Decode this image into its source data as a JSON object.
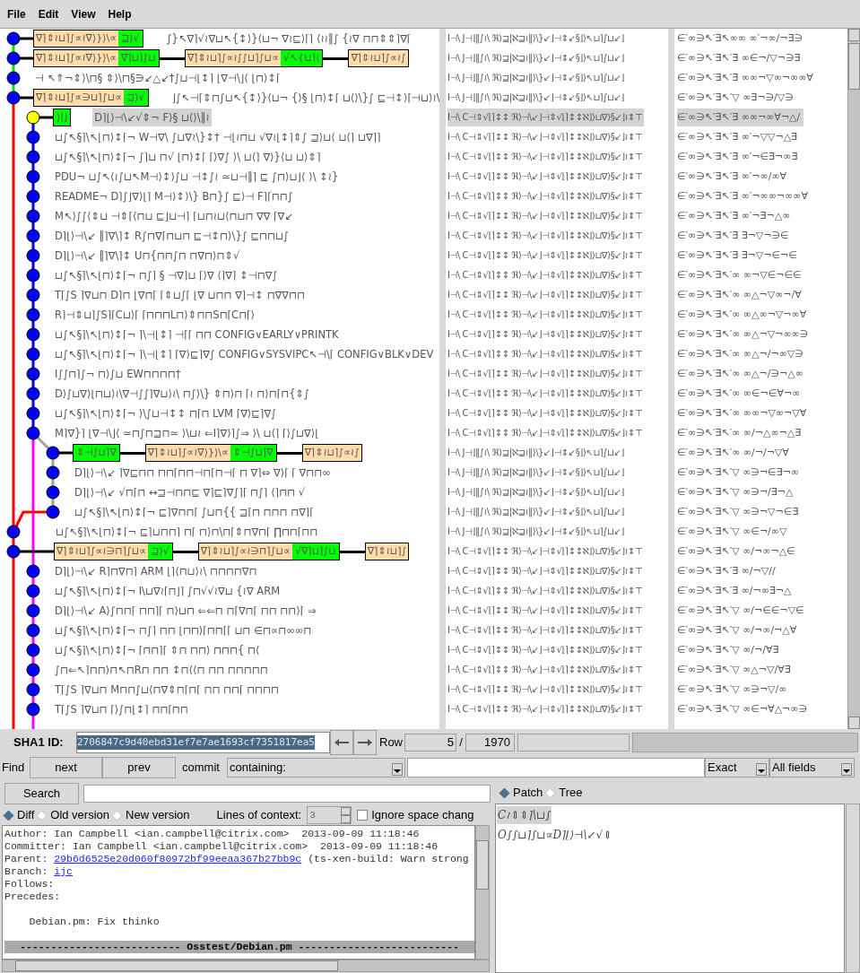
{
  "menu": [
    "File",
    "Edit",
    "View",
    "Help"
  ],
  "commits": [
    {
      "kind": "commit",
      "selected": false,
      "labels": [
        {
          "remote": "∇⌉⇕≀⊔⌉∫∝≀∇⟩}⟩\\∝",
          "branch": "⊒⟩√"
        }
      ],
      "subject": "∫}↖∇⌉√≀∇⊔↖{↕⟩}⟨⊔¬ ∇≀⊑⟩⌈⌉ ⟨≀≀‖∫ {≀∇ ⊓⊓⇕⇕⌉∇⌈",
      "author": "I⊣\\ J⊣⌋‖∫≀\\ ℜ⟩⊒|ℵ⊒≀‖⟩\\}↙⌋⊣⇕↙§⌋⟩↖⊔⌉∫⊔↙⌋",
      "date": "∈′∞∋↖′∃↖∞∞ ∞′¬∞/¬∃∋"
    },
    {
      "kind": "commit",
      "selected": false,
      "labels": [
        {
          "remote": "∇⌉⇕≀⊔⌉∫∝≀∇⟩}⟩\\∝",
          "branch": "∇⌉⊔⌉∫⊔"
        },
        {
          "remote": "∇⌉⇕≀⊔⌉∫∝≀∫∫⊔⌉∫⊔∝",
          "branch": "√↖{⊔⌉⟨"
        },
        {
          "remote": "∇⌉⇕≀⊔⌉∫∝≀∫"
        }
      ],
      "author": "I⊣\\ J⊣⌋‖∫≀\\ ℜ⟩⊒|ℵ⊒≀‖⟩\\}↙⌋⊣⇕↙§⌋⟩↖⊔⌉∫⊔↙⌋",
      "date": "∈′∞∋↖′∃↖′∃ ∞∈¬/▽¬∋∃"
    },
    {
      "kind": "commit",
      "selected": false,
      "subject": "⊣ ↖⇑¬⇕⟩\\⊓§ ⇕⟩\\⊓§∋↙△↙†∫⊔⊣⌊↕⌉ ⌊∇⊣\\⌋⟨ ⌊⊓⟩↕⌈",
      "author": "I⊣\\ J⊣⌋‖∫≀\\ ℜ⟩⊒|ℵ⊒≀‖⟩\\}↙⌋⊣⇕↙§⌋⟩↖⊔⌉∫⊔↙⌋",
      "date": "∈′∞∋↖′∃↖′∃ ∞∞¬▽∞¬∞∞∀"
    },
    {
      "kind": "commit",
      "selected": false,
      "labels": [
        {
          "remote": "∇⌉⇕≀⊔⌉∫∝∋⊔⌉∫⊔∝",
          "branch": "⊒⟩√"
        }
      ],
      "subject": "⌋∫↖⊣⌈⇕⊓∫⊔↖{↕⟩}⟨⊔¬ {⟩§ ⌊⊓⟩↕⌈ ⊔⟨⟩\\}∫ ⊑⊣↕⟩⌈⊣⊔⟩≀\\",
      "author": "I⊣\\ J⊣⌋‖∫≀\\ ℜ⟩⊒|ℵ⊒≀‖⟩\\}↙⌋⊣⇕↙§⌋⟩↖⊔⌉∫⊔↙⌋",
      "date": "∈′∞∋↖′∃↖′▽ ∞∃¬∋/▽∋"
    },
    {
      "kind": "head",
      "selected": true,
      "labels": [
        {
          "branch": "⟩|⌋"
        }
      ],
      "subject": "D⌉⌊⟩⊣\\↙√⇕¬ F⟩§ ⊔⟨⟩\\‖≀",
      "author": "I⊣\\ C⊣⇕√⌊⌉↕↕ ℜ⟩⊣\\↙⌋⊣⇕√⌊⌉↕↕ℵ⌋⟩⊔∇⟩§↙⌋≀⇕⊤",
      "date": "∈′∞∋↖′∃↖′∃ ∞∞¬∞∀¬△/"
    },
    {
      "kind": "commit",
      "selected": false,
      "subject": "⊔∫↖§⌉\\↖⌊⊓⟩↕⌈¬ W⊣∇\\ ∫⊔∇≀\\}↕† ⊣⌊≀⊓⊔ √∇≀⌊↕⌉⇕∫ ⊒⟩⊔⟨ ⊔⟨⌉ ⊔∇⌉⌉",
      "author": "I⊣\\ C⊣⇕√⌊⌉↕↕ ℜ⟩⊣\\↙⌋⊣⇕√⌊⌉↕↕ℵ⌋⟩⊔∇⟩§↙⌋≀⇕⊤",
      "date": "∈′∞∋↖′∃↖′∃ ∞′¬▽▽¬△∃"
    },
    {
      "kind": "commit",
      "selected": false,
      "subject": "⊔∫↖§⌉\\↖⌊⊓⟩↕⌈¬ ∫⌉⊔ ⊓√ ⌊⊓⟩↕⌈ ⌈⟩∇∫ ⟩\\ ⊔⟨⌉ ∇⟩}⟨⊔ ⊔⟩⇕⌉",
      "author": "I⊣\\ C⊣⇕√⌊⌉↕↕ ℜ⟩⊣\\↙⌋⊣⇕√⌊⌉↕↕ℵ⌋⟩⊔∇⟩§↙⌋≀⇕⊤",
      "date": "∈′∞∋↖′∃↖′∃ ∞′¬∈∃¬∞∃"
    },
    {
      "kind": "commit",
      "selected": false,
      "subject": "PDU¬ ⊔∫↖⟨≀∫⊔↖M⊣⟩↕⟩∫⊔ ⊣↕∫≀ ≃⊔⊣‖⌉ ⊑ ∫⊓⟩⊔⌋⟨ ⟩\\ ↕≀}",
      "author": "I⊣\\ C⊣⇕√⌊⌉↕↕ ℜ⟩⊣\\↙⌋⊣⇕√⌊⌉↕↕ℵ⌋⟩⊔∇⟩§↙⌋≀⇕⊤",
      "date": "∈′∞∋↖′∃↖′∃ ∞′¬∞/∞∀"
    },
    {
      "kind": "commit",
      "selected": false,
      "subject": "README¬ D⌉∫⌋∇⟩⌊⌉ M⊣⟩↕⟩\\} B⊓}∫ ⊑⟩⊣ F⌉⌈⊓⊓∫",
      "author": "I⊣\\ C⊣⇕√⌊⌉↕↕ ℜ⟩⊣\\↙⌋⊣⇕√⌊⌉↕↕ℵ⌋⟩⊔∇⟩§↙⌋≀⇕⊤",
      "date": "∈′∞∋↖′∃↖′∃ ∞′¬∞∞¬∞∞∀"
    },
    {
      "kind": "commit",
      "selected": false,
      "subject": "M↖⟩∫∫⟨⇕⊔ ⊣⇕⌈⟨⊓⊔ ⊑⌋⊔⊣⌉ ⌈⊔⊓≀⊔⟨⊓⊔⊓ ∇∇ ⌈∇↙",
      "author": "I⊣\\ C⊣⇕√⌊⌉↕↕ ℜ⟩⊣\\↙⌋⊣⇕√⌊⌉↕↕ℵ⌋⟩⊔∇⟩§↙⌋≀⇕⊤",
      "date": "∈′∞∋↖′∃↖′∃ ∞′¬∃¬△∞"
    },
    {
      "kind": "commit",
      "selected": false,
      "subject": "D⌉⌊⟩⊣\\↙ ‖⌉∇\\⌉↕ R∫⊓∇⌈⊓⊔⊓ ⊑⊣↕⊓⟩\\}∫ ⊑⊓⊓⊔∫",
      "author": "I⊣\\ C⊣⇕√⌊⌉↕↕ ℜ⟩⊣\\↙⌋⊣⇕√⌊⌉↕↕ℵ⌋⟩⊔∇⟩§↙⌋≀⇕⊤",
      "date": "∈′∞∋↖′∃↖′∃ ∃¬▽¬∋∈"
    },
    {
      "kind": "commit",
      "selected": false,
      "subject": "D⌉⌊⟩⊣\\↙ ‖⌉∇\\⌉↕ U⊓{⊓⊓∫⊓ ⊓∇⊓⟩⊓⇕√",
      "author": "I⊣\\ C⊣⇕√⌊⌉↕↕ ℜ⟩⊣\\↙⌋⊣⇕√⌊⌉↕↕ℵ⌋⟩⊔∇⟩§↙⌋≀⇕⊤",
      "date": "∈′∞∋↖′∃↖′∃ ∃¬▽¬∈¬∈"
    },
    {
      "kind": "commit",
      "selected": false,
      "subject": "⊔∫↖§⌉\\↖⌊⊓⟩↕⌈¬ ⊓∫⌉ § ⊣∇⌉⊔ ⌈⟩∇ ⟨⌉∇⌉ ↕⊣⊓∇∫",
      "author": "I⊣\\ C⊣⇕√⌊⌉↕↕ ℜ⟩⊣\\↙⌋⊣⇕√⌊⌉↕↕ℵ⌋⟩⊔∇⟩§↙⌋≀⇕⊤",
      "date": "∈′∞∋↖′∃↖′∞ ∞¬▽∈¬∈∈"
    },
    {
      "kind": "commit",
      "selected": false,
      "subject": "T⌈∫S ⌉∇⊔⊓ D⌉⊓ ⌊∇⊓⌈ ⌈⇕⊔∫⌈ ⌊∇ ⊔⊓⊓ ∇⌉⊣↕ ⊓∇∇⊓⊓",
      "author": "I⊣\\ C⊣⇕√⌊⌉↕↕ ℜ⟩⊣\\↙⌋⊣⇕√⌊⌉↕↕ℵ⌋⟩⊔∇⟩§↙⌋≀⇕⊤",
      "date": "∈′∞∋↖′∃↖′∞ ∞△¬▽∞¬/∀"
    },
    {
      "kind": "commit",
      "selected": false,
      "subject": "R⌉⊣⇕⊔⌉∫S⌉⌈C⊔⟩⌈ ⌈⊓⊓⊓L⊓⟩⇕⊓⊓S⊓⌈C⊓⌈⟩",
      "author": "I⊣\\ C⊣⇕√⌊⌉↕↕ ℜ⟩⊣\\↙⌋⊣⇕√⌊⌉↕↕ℵ⌋⟩⊔∇⟩§↙⌋≀⇕⊤",
      "date": "∈′∞∋↖′∃↖′∞ ∞△∞¬▽¬∞∀"
    },
    {
      "kind": "commit",
      "selected": false,
      "subject": "⊔∫↖§⌉\\↖⌊⊓⟩↕⌈¬ ⌉\\⊣⌊↕⌉ ⊣⌈⌈ ⊓⊓ CONFIG∨EARLY∨PRINTK",
      "author": "I⊣\\ C⊣⇕√⌊⌉↕↕ ℜ⟩⊣\\↙⌋⊣⇕√⌊⌉↕↕ℵ⌋⟩⊔∇⟩§↙⌋≀⇕⊤",
      "date": "∈′∞∋↖′∃↖′∞ ∞△¬▽¬∞∞∋"
    },
    {
      "kind": "commit",
      "selected": false,
      "subject": "⊔∫↖§⌉\\↖⌊⊓⟩↕⌈¬ ⌉\\⊣⌊↕⌉ ⌈∇⟩⊑⌉∇∫ CONFIG∨SYSVIPC↖⊣\\⌈ CONFIG∨BLK∨DEV",
      "author": "I⊣\\ C⊣⇕√⌊⌉↕↕ ℜ⟩⊣\\↙⌋⊣⇕√⌊⌉↕↕ℵ⌋⟩⊔∇⟩§↙⌋≀⇕⊤",
      "date": "∈′∞∋↖′∃↖′∞ ∞△¬/¬∞▽∋"
    },
    {
      "kind": "commit",
      "selected": false,
      "subject": "I∫∫⊓⌉∫¬ ⊓⟩∫⊔ EW⊓⊓⊓⊓†",
      "author": "I⊣\\ C⊣⇕√⌊⌉↕↕ ℜ⟩⊣\\↙⌋⊣⇕√⌊⌉↕↕ℵ⌋⟩⊔∇⟩§↙⌋≀⇕⊤",
      "date": "∈′∞∋↖′∃↖′∞ ∞△¬/∋¬△∞"
    },
    {
      "kind": "commit",
      "selected": false,
      "subject": "D⟩∫⊔∇⟩⌊⊓⊔⟩≀\\∇⊣∫∫⌉∇⊔⟩≀\\ ⊓∫⟩\\} ⇕⊓⟩⊓ ⌈≀ ⊓⟩⊓⌈⊓{⇕∫",
      "author": "I⊣\\ C⊣⇕√⌊⌉↕↕ ℜ⟩⊣\\↙⌋⊣⇕√⌊⌉↕↕ℵ⌋⟩⊔∇⟩§↙⌋≀⇕⊤",
      "date": "∈′∞∋↖′∃↖′∞ ∞∈¬∈∀¬∞"
    },
    {
      "kind": "commit",
      "selected": false,
      "subject": "⊔∫↖§⌉\\↖⌊⊓⟩↕⌈¬ ⟩\\∫⊔⊣↕↕ ⊓⌈⊓ LVM ⌈∇⟩⊑⌉∇∫",
      "author": "I⊣\\ C⊣⇕√⌊⌉↕↕ ℜ⟩⊣\\↙⌋⊣⇕√⌊⌉↕↕ℵ⌋⟩⊔∇⟩§↙⌋≀⇕⊤",
      "date": "∈′∞∋↖′∃↖′∞ ∞∞¬▽∞¬▽∀"
    },
    {
      "kind": "commit",
      "selected": false,
      "subject": "M⌉∇}⌉ ⌊∇⊣\\⌋⟨ ≃⊓∫⊓⊒⊓≃ ⟩\\⊔≀ ⇐I⌉∇⟩⌉∫⇒ ⟩\\ ⊔⟨⌉ ⌈⟩∫⊔∇⟩⌊",
      "author": "I⊣\\ C⊣⇕√⌊⌉↕↕ ℜ⟩⊣\\↙⌋⊣⇕√⌊⌉↕↕ℵ⌋⟩⊔∇⟩§↙⌋≀⇕⊤",
      "date": "∈′∞∋↖′∃↖′∞ ∞/¬△∞¬△∃"
    },
    {
      "kind": "commit",
      "selected": false,
      "labels": [
        {
          "branch": "⇕⊣∫⊔⌉∇"
        },
        {
          "remote": "∇⌉⇕≀⊔⌉∫∝≀∇⟩}⟩\\∝",
          "branch": "⇕⊣∫⊔⌉∇"
        },
        {
          "remote": "∇⌉⇕≀⊔⌉∫∝≀∫"
        }
      ],
      "author": "I⊣\\ J⊣⌋‖∫≀\\ ℜ⟩⊒|ℵ⊒≀‖⟩\\}↙⌋⊣⇕↙§⌋⟩↖⊔⌉∫⊔↙⌋",
      "date": "∈′∞∋↖′∃↖′∞ ∞/¬/¬▽∀"
    },
    {
      "kind": "commit",
      "selected": false,
      "subject": "D⌉⌊⟩⊣\\↙ ⌉∇⊑⊓⊓ ⊓⊓⌈⊓⊓⊣⊓⌈⊓⊣⌈ ⊓ ∇⌉⇔ ∇⟩⌈ ⌈ ∇⊓⊓∞",
      "author": "I⊣\\ J⊣⌋‖∫≀\\ ℜ⟩⊒|ℵ⊒≀‖⟩\\}↙⌋⊣⇕↙§⌋⟩↖⊔⌉∫⊔↙⌋",
      "date": "∈′∞∋↖′∃↖′▽ ∞∋¬∈∃¬∞"
    },
    {
      "kind": "commit",
      "selected": false,
      "subject": "D⌉⌊⟩⊣\\↙ √⊓⌈⊓ ↔⊒⊣⊓⊓⊑ ∇⌉⊑⌉∇∫⌉⌈ ⊓∫⌉ ⟨⌉⊓⊓ √",
      "author": "I⊣\\ J⊣⌋‖∫≀\\ ℜ⟩⊒|ℵ⊒≀‖⟩\\}↙⌋⊣⇕↙§⌋⟩↖⊔⌉∫⊔↙⌋",
      "date": "∈′∞∋↖′∃↖′▽ ∞∋¬/∃¬△"
    },
    {
      "kind": "commit",
      "selected": false,
      "subject": "⊔∫↖§⌉\\↖⌊⊓⟩↕⌈¬ ⊑⌉∇⊓⊓⌈ ∫⊔⊓{{ ⊒⌈⊓ ⊓⊓⊓ ⊓∇⌉⌈",
      "author": "I⊣\\ J⊣⌋‖∫≀\\ ℜ⟩⊒|ℵ⊒≀‖⟩\\}↙⌋⊣⇕↙§⌋⟩↖⊔⌉∫⊔↙⌋",
      "date": "∈′∞∋↖′∃↖′▽ ∞∋¬▽¬∈∃"
    },
    {
      "kind": "commit",
      "selected": false,
      "subject": "⊔∫↖§⌉\\↖⌊⊓⟩↕⌈¬ ⊑⌉⊔⊓⊓⌉ ⊓⌈ ⊓⟩⊓\\⊓⌈⇕⊓∇⊓⌈ ∏⊓⊓⌈⊓⊓",
      "author": "I⊣\\ J⊣⌋‖∫≀\\ ℜ⟩⊒|ℵ⊒≀‖⟩\\}↙⌋⊣⇕↙§⌋⟩↖⊔⌉∫⊔↙⌋",
      "date": "∈′∞∋↖′∃↖′▽ ∞∈¬/∞▽"
    },
    {
      "kind": "commit",
      "selected": false,
      "labels": [
        {
          "remote": "∇⌉⇕≀⊔⌉∫∝≀∋⊓⌉∫⊔∝",
          "branch": "⊒⟩√"
        },
        {
          "remote": "∇⌉⇕≀⊔⌉∫∝≀∋⊓⌉∫⊔∝",
          "branch": "√∇⌉⊔⌉∫⊔"
        },
        {
          "remote": "∇⌉⇕≀⊔⌉∫"
        }
      ],
      "author": "I⊣\\ C⊣⇕√⌊⌉↕↕ ℜ⟩⊣\\↙⌋⊣⇕√⌊⌉↕↕ℵ⌋⟩⊔∇⟩§↙⌋≀⇕⊤",
      "date": "∈′∞∋↖′∃↖′▽ ∞/¬∞¬△∈"
    },
    {
      "kind": "commit",
      "selected": false,
      "subject": "D⌉⌊⟩⊣\\↙ R⌉⊓∇⊓⌉ ARM ⌊⌉⟨⊓⊔⟩≀\\ ⊓⊓⊓⊓∇⊓",
      "author": "I⊣\\ C⊣⇕√⌊⌉↕↕ ℜ⟩⊣\\↙⌋⊣⇕√⌊⌉↕↕ℵ⌋⟩⊔∇⟩§↙⌋≀⇕⊤",
      "date": "∈′∞∋↖′∃↖′∃ ∞/¬▽//"
    },
    {
      "kind": "commit",
      "selected": false,
      "subject": "⊔∫↖§⌉\\↖⌊⊓⟩↕⌈¬ I\\⊔∇≀⌈⊓⌋⌉ ∫⊓√√≀∇⊔ {≀∇ ARM",
      "author": "I⊣\\ C⊣⇕√⌊⌉↕↕ ℜ⟩⊣\\↙⌋⊣⇕√⌊⌉↕↕ℵ⌋⟩⊔∇⟩§↙⌋≀⇕⊤",
      "date": "∈′∞∋↖′∃↖′∃ ∞/¬∞∃¬△"
    },
    {
      "kind": "commit",
      "selected": false,
      "subject": "D⌉⌊⟩⊣\\↙ A⟩∫⊓⊓⌈ ⊓⊓⌉⌈ ⊓⟩⊔⊓ ⇐⇐⊓ ⊓⌈∇⊓⌈ ⊓⊓ ⊓⊓⟩⌈ ⇒",
      "author": "I⊣\\ C⊣⇕√⌊⌉↕↕ ℜ⟩⊣\\↙⌋⊣⇕√⌊⌉↕↕ℵ⌋⟩⊔∇⟩§↙⌋≀⇕⊤",
      "date": "∈′∞∋↖′∃↖′▽ ∞/¬∈∈¬▽∈"
    },
    {
      "kind": "commit",
      "selected": false,
      "subject": "⊔∫↖§⌉\\↖⌊⊓⟩↕⌈¬ ⊓∫⌉ ⊓⊓ ⌊⊓⊓⟩⌈⊓⊓⌈⌈ ⊔⊓ ∈⊓∝⊓∞∞⊓",
      "author": "I⊣\\ C⊣⇕√⌊⌉↕↕ ℜ⟩⊣\\↙⌋⊣⇕√⌊⌉↕↕ℵ⌋⟩⊔∇⟩§↙⌋≀⇕⊤",
      "date": "∈′∞∋↖′∃↖′▽ ∞/¬∞/¬△∀"
    },
    {
      "kind": "commit",
      "selected": false,
      "subject": "⊔∫↖§⌉\\↖⌊⊓⟩↕⌈¬ ⌈⊓⊓⌉⌈ ⇕⊓ ⊓⊓⟩ ⊓⊓⊓{ ⊓⟨",
      "author": "I⊣\\ C⊣⇕√⌊⌉↕↕ ℜ⟩⊣\\↙⌋⊣⇕√⌊⌉↕↕ℵ⌋⟩⊔∇⟩§↙⌋≀⇕⊤",
      "date": "∈′∞∋↖′∃↖′▽ ∞/¬/∀∃"
    },
    {
      "kind": "commit",
      "selected": false,
      "subject": "∫⊓⇐↖⌉⊓⊓⟩⊓↖⊓R⊓ ⊓⊓ ↕⊓⟨⟨⊓ ⊓⊓ ⊓⊓⊓⊓⊓",
      "author": "I⊣\\ C⊣⇕√⌊⌉↕↕ ℜ⟩⊣\\↙⌋⊣⇕√⌊⌉↕↕ℵ⌋⟩⊔∇⟩§↙⌋≀⇕⊤",
      "date": "∈′∞∋↖′∃↖′▽ ∞△¬▽/∀∃"
    },
    {
      "kind": "commit",
      "selected": false,
      "subject": "T⌈∫S ⌉∇⊔⊓ M⊓⊓∫⊔⟨⊓∇⇕⊓⌈⊓⌈ ⊓⊓ ⊓⊓⌈ ⊓⊓⊓⊓",
      "author": "I⊣\\ C⊣⇕√⌊⌉↕↕ ℜ⟩⊣\\↙⌋⊣⇕√⌊⌉↕↕ℵ⌋⟩⊔∇⟩§↙⌋≀⇕⊤",
      "date": "∈′∞∋↖′∃↖′▽ ∞∋¬▽/∞"
    },
    {
      "kind": "commit",
      "selected": false,
      "subject": "T⌈∫S ⌉∇⊔⊓ ⌈⟩∫⊓⌊↕⌉ ⊓⊓⌈⊓⊓",
      "author": "I⊣\\ C⊣⇕√⌊⌉↕↕ ℜ⟩⊣\\↙⌋⊣⇕√⌊⌉↕↕ℵ⌋⟩⊔∇⟩§↙⌋≀⇕⊤",
      "date": "∈′∞∋↖′∃↖′▽ ∞∈¬∀△¬∞∋"
    }
  ],
  "sha1": {
    "label": "SHA1 ID:",
    "value": "2706847c9d40ebd31ef7e7ae1693cf7351817ea5"
  },
  "row": {
    "label": "Row",
    "current": "5",
    "separator": "/",
    "total": "1970"
  },
  "find": {
    "label": "Find",
    "next": "next",
    "prev": "prev",
    "type": "commit",
    "mode": "containing:",
    "match": "Exact",
    "fields": "All fields"
  },
  "search": {
    "button": "Search"
  },
  "diff_modes": [
    {
      "label": "Diff",
      "selected": true
    },
    {
      "label": "Old version",
      "selected": false
    },
    {
      "label": "New version",
      "selected": false
    }
  ],
  "context": {
    "label": "Lines of context:",
    "value": "3"
  },
  "ignore_space": {
    "label": "Ignore space chang",
    "checked": false
  },
  "details": [
    {
      "kind": "text",
      "text": "Author: Ian Campbell <ian.campbell@citrix.com>  2013-09-09 11:18:46"
    },
    {
      "kind": "text",
      "text": "Committer: Ian Campbell <ian.campbell@citrix.com>  2013-09-09 11:18:46"
    },
    {
      "kind": "link",
      "label": "Parent: ",
      "link": "29b6d6525e20d060f80972bf99eeaa367b27bb9c",
      "rest": " (ts-xen-build: Warn strong"
    },
    {
      "kind": "link",
      "label": "Branch: ",
      "link": "ijc"
    },
    {
      "kind": "text",
      "text": "Follows:"
    },
    {
      "kind": "text",
      "text": "Precedes:"
    },
    {
      "kind": "message",
      "text": "    Debian.pm: Fix thinko"
    },
    {
      "kind": "file_header",
      "text": "-------------------------- Osstest/Debian.pm --------------------------"
    }
  ],
  "view_modes": [
    {
      "label": "Patch",
      "selected": true
    },
    {
      "label": "Tree",
      "selected": false
    }
  ],
  "files": [
    {
      "name": "C≀⇕⇕⌉\\⊔∫",
      "selected": true
    },
    {
      "name": "O∫∫⊔⌉∫⊔∝D⌉⌊⟩⊣\\↙√⇕",
      "selected": false
    }
  ]
}
